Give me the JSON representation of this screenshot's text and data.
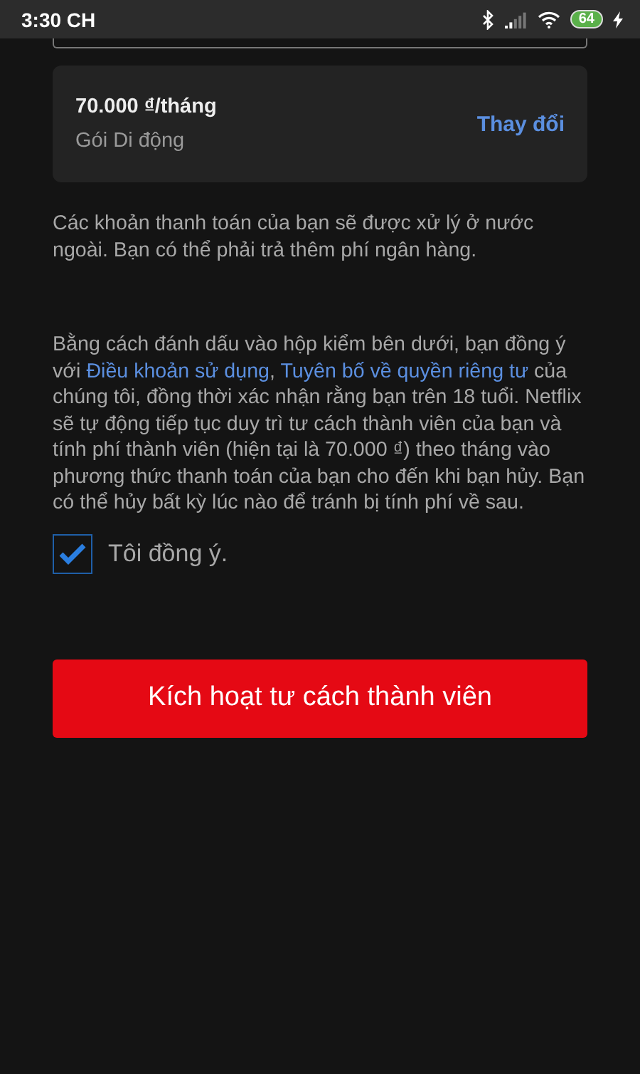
{
  "status_bar": {
    "time": "3:30 CH",
    "battery": "64"
  },
  "plan": {
    "price": "70.000 ₫/tháng",
    "name": "Gói Di động",
    "change": "Thay đổi"
  },
  "notice": "Các khoản thanh toán của bạn sẽ được xử lý ở nước ngoài. Bạn có thể phải trả thêm phí ngân hàng.",
  "consent": {
    "before": "Bằng cách đánh dấu vào hộp kiểm bên dưới, bạn đồng ý với ",
    "links": [
      "Điều khoản sử dụng",
      "Tuyên bố về quyền riêng tư"
    ],
    "separator": ", ",
    "after": " của chúng tôi, đồng thời xác nhận rằng bạn trên 18 tuổi. Netflix sẽ tự động tiếp tục duy trì tư cách thành viên của bạn và tính phí thành viên (hiện tại là 70.000 ₫) theo tháng vào phương thức thanh toán của bạn cho đến khi bạn hủy. Bạn có thể hủy bất kỳ lúc nào để tránh bị tính phí về sau."
  },
  "agree": {
    "label": "Tôi đồng ý.",
    "checked": true
  },
  "submit": "Kích hoạt tư cách thành viên"
}
